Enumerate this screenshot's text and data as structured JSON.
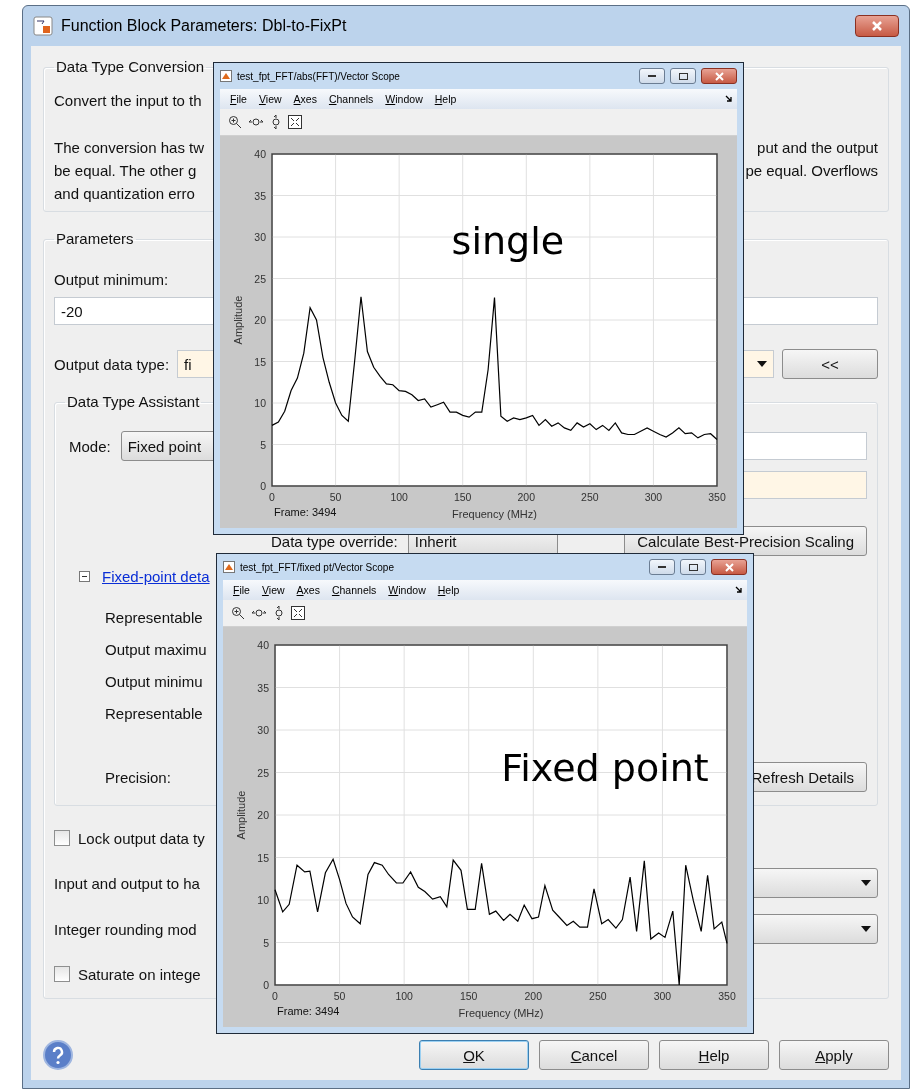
{
  "dialog": {
    "title": "Function Block Parameters: Dbl-to-FixPt",
    "description": {
      "title": "Data Type Conversion",
      "lines": [
        {
          "left": "Convert the input to th"
        },
        {
          "left": "The conversion has tw",
          "right": "put and the output"
        },
        {
          "left": "be equal.  The other g",
          "right": "pe equal.  Overflows"
        },
        {
          "left": "and quantization erro"
        }
      ]
    },
    "parameters": {
      "title": "Parameters",
      "output_minimum": {
        "label": "Output minimum:",
        "value": "-20"
      },
      "output_data_type": {
        "label": "Output data type:",
        "value": "fi",
        "button": "<<"
      },
      "assistant": {
        "title": "Data Type Assistant",
        "mode_label": "Mode:",
        "mode_value": "Fixed point",
        "override_label": "Data type override:",
        "override_value": "Inherit",
        "scaling_button": "Calculate Best-Precision Scaling",
        "details": {
          "expanded": true,
          "link": "Fixed-point deta",
          "rows": [
            "Representable",
            "Output maximu",
            "Output minimu",
            "Representable"
          ],
          "precision_label": "Precision:",
          "refresh_button": "Refresh Details"
        }
      }
    },
    "options": [
      {
        "kind": "checkbox",
        "label": "Lock output data ty",
        "checked": false
      },
      {
        "kind": "dropdown",
        "label": "Input and output to ha"
      },
      {
        "kind": "dropdown",
        "label": "Integer rounding mod"
      },
      {
        "kind": "checkbox",
        "label": "Saturate on intege",
        "checked": false
      }
    ],
    "buttons": [
      {
        "label": "OK",
        "default": true
      },
      {
        "label": "Cancel",
        "default": false
      },
      {
        "label": "Help",
        "default": false
      },
      {
        "label": "Apply",
        "default": false
      }
    ]
  },
  "scopes": [
    {
      "title": "test_fpt_FFT/abs(FFT)/Vector Scope",
      "menu": [
        "File",
        "View",
        "Axes",
        "Channels",
        "Window",
        "Help"
      ],
      "frame_label": "Frame: 3494",
      "chart_data": {
        "type": "line",
        "xlabel": "Frequency (MHz)",
        "ylabel": "Amplitude",
        "xlim": [
          0,
          350
        ],
        "ylim": [
          0,
          40
        ],
        "xticks": [
          0,
          50,
          100,
          150,
          200,
          250,
          300,
          350
        ],
        "yticks": [
          0,
          5,
          10,
          15,
          20,
          25,
          30,
          35,
          40
        ],
        "annotations": [
          "single"
        ],
        "grid": true,
        "x": [
          0,
          5,
          10,
          15,
          20,
          25,
          30,
          35,
          40,
          45,
          50,
          55,
          60,
          65,
          70,
          75,
          80,
          85,
          90,
          95,
          100,
          105,
          110,
          115,
          120,
          125,
          130,
          135,
          140,
          145,
          150,
          155,
          160,
          165,
          170,
          175,
          180,
          185,
          190,
          195,
          200,
          205,
          210,
          215,
          220,
          225,
          230,
          235,
          240,
          245,
          250,
          255,
          260,
          265,
          270,
          275,
          280,
          285,
          290,
          295,
          300,
          305,
          310,
          315,
          320,
          325,
          330,
          335,
          340,
          345,
          350
        ],
        "series": [
          {
            "color": "#000000",
            "values": [
              7.3,
              7.7,
              9,
              11.5,
              13,
              16,
              21.5,
              20,
              15.5,
              12.5,
              10,
              8.5,
              7.8,
              15,
              22.8,
              16.2,
              14.3,
              13.2,
              12.3,
              12.2,
              11.5,
              11.4,
              11,
              10.3,
              10.5,
              9.5,
              9.8,
              10.1,
              8.9,
              8.9,
              8.5,
              8.3,
              8.9,
              8.9,
              14,
              22.7,
              8.4,
              7.8,
              8.2,
              8,
              8.2,
              8.5,
              7.3,
              8,
              7.2,
              7.6,
              7,
              6.7,
              7.6,
              7.1,
              7.5,
              6.8,
              7.3,
              6.7,
              7.6,
              6.4,
              6.2,
              6.2,
              6.6,
              7,
              6.6,
              6.2,
              5.9,
              6.4,
              7,
              6.3,
              6.4,
              5.8,
              6.2,
              6.3,
              5.6
            ]
          }
        ]
      }
    },
    {
      "title": "test_fpt_FFT/fixed pt/Vector Scope",
      "menu": [
        "File",
        "View",
        "Axes",
        "Channels",
        "Window",
        "Help"
      ],
      "frame_label": "Frame: 3494",
      "chart_data": {
        "type": "line",
        "xlabel": "Frequency (MHz)",
        "ylabel": "Amplitude",
        "xlim": [
          0,
          350
        ],
        "ylim": [
          0,
          40
        ],
        "xticks": [
          0,
          50,
          100,
          150,
          200,
          250,
          300,
          350
        ],
        "yticks": [
          0,
          5,
          10,
          15,
          20,
          25,
          30,
          35,
          40
        ],
        "annotations": [
          "Fixed point"
        ],
        "grid": true,
        "x": [
          0,
          6,
          11,
          17,
          23,
          27,
          33,
          39,
          45,
          50,
          55,
          60,
          66,
          72,
          77,
          83,
          88,
          94,
          99,
          105,
          111,
          116,
          122,
          128,
          133,
          138,
          144,
          149,
          155,
          160,
          166,
          171,
          177,
          182,
          188,
          193,
          199,
          204,
          209,
          215,
          220,
          226,
          231,
          236,
          242,
          247,
          253,
          258,
          264,
          269,
          275,
          280,
          286,
          291,
          297,
          302,
          308,
          313,
          318,
          324,
          330,
          335,
          340,
          346,
          350
        ],
        "series": [
          {
            "color": "#000000",
            "values": [
              11.2,
              8.6,
              9.5,
              14.1,
              13.3,
              13.4,
              8.6,
              13.2,
              14.8,
              12.4,
              9.6,
              8,
              7.2,
              13,
              14.4,
              14.1,
              13,
              12,
              12,
              13.3,
              11.5,
              11,
              10.1,
              10.4,
              9.2,
              14.7,
              13.5,
              8.9,
              8.9,
              14.3,
              8.3,
              8.7,
              7.6,
              8.3,
              7.5,
              9.4,
              7.8,
              8,
              11.7,
              8.8,
              8,
              7,
              7.5,
              6.8,
              6.8,
              11.3,
              7.2,
              7.7,
              6.7,
              7.7,
              12.7,
              6.3,
              14.6,
              5.4,
              6.1,
              5.6,
              8.7,
              0,
              14.1,
              9.9,
              6.3,
              12.9,
              6.6,
              7.4,
              4.9
            ]
          }
        ]
      }
    }
  ]
}
